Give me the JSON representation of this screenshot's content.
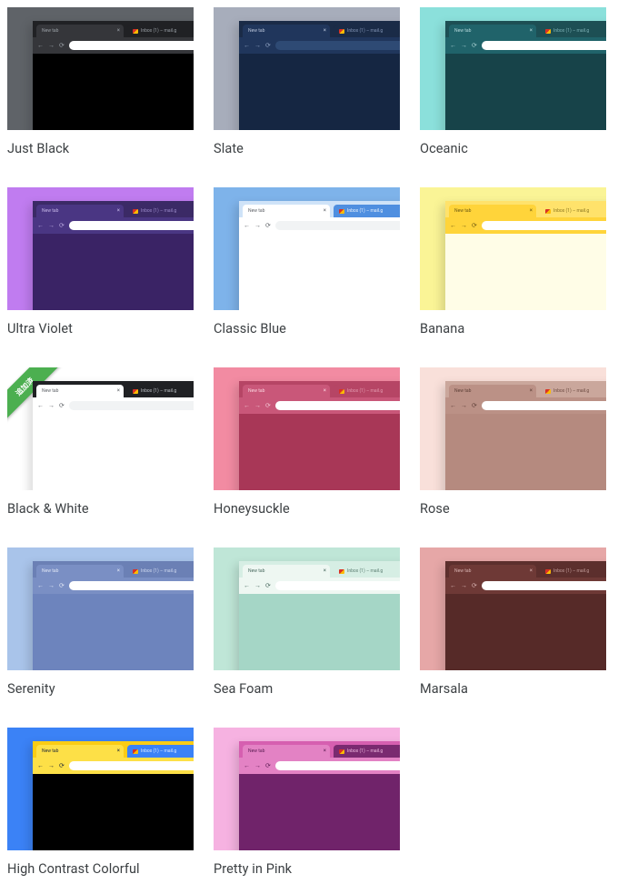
{
  "new_tab_label": "New tab",
  "bg_tab_label": "Inbox (1) – mail.g",
  "ribbon_text": "追加済",
  "themes": [
    {
      "name": "Just Black",
      "bg": "#5f6368",
      "tabstrip": "#202124",
      "tab_active": "#35363a",
      "tab_bg": "#202124",
      "toolbar": "#35363a",
      "omnibox": "#ffffff",
      "page": "#000000",
      "text_active": "#9aa0a6",
      "text_bg": "#9aa0a6",
      "nav": "#9aa0a6",
      "ribbon": false
    },
    {
      "name": "Slate",
      "bg": "#a7adbb",
      "tabstrip": "#1a2b47",
      "tab_active": "#20365c",
      "tab_bg": "#1a2b47",
      "toolbar": "#20365c",
      "omnibox": "#2e4a74",
      "page": "#152642",
      "text_active": "#b8c4d9",
      "text_bg": "#8294b5",
      "nav": "#8ea1c2",
      "ribbon": false
    },
    {
      "name": "Oceanic",
      "bg": "#8be0db",
      "tabstrip": "#1d4f54",
      "tab_active": "#20636a",
      "tab_bg": "#1d4f54",
      "toolbar": "#20636a",
      "omnibox": "#ffffff",
      "page": "#174349",
      "text_active": "#b6d9dc",
      "text_bg": "#7fb3b7",
      "nav": "#a8cfd2",
      "ribbon": false
    },
    {
      "name": "Ultra Violet",
      "bg": "#c07cf0",
      "tabstrip": "#3b2a66",
      "tab_active": "#4a3683",
      "tab_bg": "#3b2a66",
      "toolbar": "#4a3683",
      "omnibox": "#ffffff",
      "page": "#3a2365",
      "text_active": "#c6b7e8",
      "text_bg": "#9d8ccc",
      "nav": "#b9a8e0",
      "ribbon": false
    },
    {
      "name": "Classic Blue",
      "bg": "#7eb3ea",
      "tabstrip": "#cfe3f8",
      "tab_active": "#ffffff",
      "tab_bg": "#4f8fe0",
      "toolbar": "#ffffff",
      "omnibox": "#f1f3f4",
      "page": "#ffffff",
      "text_active": "#5f6368",
      "text_bg": "#eef5fd",
      "nav": "#5f6368",
      "ribbon": false
    },
    {
      "name": "Banana",
      "bg": "#faf496",
      "tabstrip": "#ffe26b",
      "tab_active": "#ffd43a",
      "tab_bg": "#ffe26b",
      "toolbar": "#ffd43a",
      "omnibox": "#ffffff",
      "page": "#fffde7",
      "text_active": "#6d5a12",
      "text_bg": "#8a751f",
      "nav": "#6d5a12",
      "ribbon": false
    },
    {
      "name": "Black & White",
      "bg": "#ffffff",
      "tabstrip": "#202124",
      "tab_active": "#ffffff",
      "tab_bg": "#202124",
      "toolbar": "#ffffff",
      "omnibox": "#f1f3f4",
      "page": "#ffffff",
      "text_active": "#5f6368",
      "text_bg": "#bdc1c6",
      "nav": "#5f6368",
      "ribbon": true
    },
    {
      "name": "Honeysuckle",
      "bg": "#f28ba2",
      "tabstrip": "#b64565",
      "tab_active": "#c95779",
      "tab_bg": "#b64565",
      "toolbar": "#c95779",
      "omnibox": "#ffffff",
      "page": "#a83757",
      "text_active": "#fbd3de",
      "text_bg": "#e39bb0",
      "nav": "#f2c3d0",
      "ribbon": false
    },
    {
      "name": "Rose",
      "bg": "#f9e0da",
      "tabstrip": "#caa79c",
      "tab_active": "#bb9186",
      "tab_bg": "#caa79c",
      "toolbar": "#bb9186",
      "omnibox": "#ffffff",
      "page": "#b58a7f",
      "text_active": "#5e4038",
      "text_bg": "#6c4a41",
      "nav": "#5e4038",
      "ribbon": false
    },
    {
      "name": "Serenity",
      "bg": "#a9c4ea",
      "tabstrip": "#6b80b5",
      "tab_active": "#7a8fc4",
      "tab_bg": "#6b80b5",
      "toolbar": "#7a8fc4",
      "omnibox": "#ffffff",
      "page": "#6d84bd",
      "text_active": "#e0e6f5",
      "text_bg": "#cfd8ef",
      "nav": "#e0e6f5",
      "ribbon": false
    },
    {
      "name": "Sea Foam",
      "bg": "#bfe6d7",
      "tabstrip": "#d6eee4",
      "tab_active": "#eef7f2",
      "tab_bg": "#d6eee4",
      "toolbar": "#eef7f2",
      "omnibox": "#ffffff",
      "page": "#a5d6c6",
      "text_active": "#4a6b60",
      "text_bg": "#5b7d71",
      "nav": "#4a6b60",
      "ribbon": false
    },
    {
      "name": "Marsala",
      "bg": "#e6a7a7",
      "tabstrip": "#5c2f2d",
      "tab_active": "#6e3936",
      "tab_bg": "#5c2f2d",
      "toolbar": "#6e3936",
      "omnibox": "#ffffff",
      "page": "#562a28",
      "text_active": "#d9b4b2",
      "text_bg": "#c29c9a",
      "nav": "#d9b4b2",
      "ribbon": false
    },
    {
      "name": "High Contrast Colorful",
      "bg": "#3b82f6",
      "tabstrip": "#facc15",
      "tab_active": "#fde047",
      "tab_bg": "#3b82f6",
      "toolbar": "#fde047",
      "omnibox": "#ffffff",
      "page": "#000000",
      "text_active": "#1f2937",
      "text_bg": "#e0ecff",
      "nav": "#1f2937",
      "ribbon": false
    },
    {
      "name": "Pretty in Pink",
      "bg": "#f6b2e1",
      "tabstrip": "#d65fb0",
      "tab_active": "#e382c4",
      "tab_bg": "#7a2a70",
      "toolbar": "#e382c4",
      "omnibox": "#ffffff",
      "page": "#70236a",
      "text_active": "#5a1c52",
      "text_bg": "#f1bce2",
      "nav": "#5a1c52",
      "ribbon": false
    }
  ]
}
